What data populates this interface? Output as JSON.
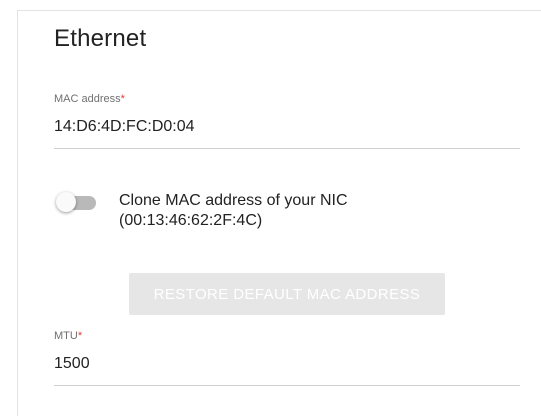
{
  "section": {
    "title": "Ethernet"
  },
  "mac": {
    "label": "MAC address",
    "required_mark": "*",
    "value": "14:D6:4D:FC:D0:04"
  },
  "clone": {
    "label_line1": "Clone MAC address of your NIC",
    "label_line2": "(00:13:46:62:2F:4C)",
    "enabled": false
  },
  "restore_button": {
    "label": "RESTORE DEFAULT MAC ADDRESS",
    "disabled": true
  },
  "mtu": {
    "label": "MTU",
    "required_mark": "*",
    "value": "1500"
  },
  "colors": {
    "required": "#e53935",
    "text": "#222222",
    "label": "#707070",
    "toggle_track_off": "#b9b9b9",
    "disabled_button_bg": "#e6e6e6"
  }
}
